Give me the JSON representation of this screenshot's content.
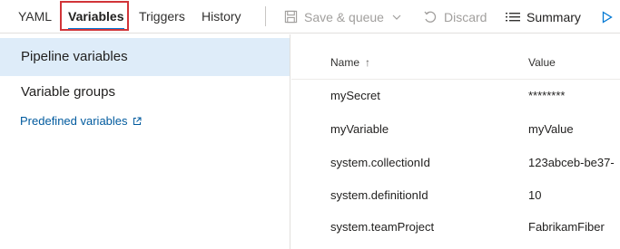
{
  "toolbar": {
    "tabs": [
      {
        "label": "YAML"
      },
      {
        "label": "Variables"
      },
      {
        "label": "Triggers"
      },
      {
        "label": "History"
      }
    ],
    "save_queue_label": "Save & queue",
    "discard_label": "Discard",
    "summary_label": "Summary"
  },
  "sidebar": {
    "items": [
      {
        "label": "Pipeline variables",
        "selected": true
      },
      {
        "label": "Variable groups",
        "selected": false
      }
    ],
    "predefined_link": "Predefined variables"
  },
  "table": {
    "columns": {
      "name": "Name",
      "value": "Value"
    },
    "rows": [
      {
        "name": "mySecret",
        "value": "********"
      },
      {
        "name": "myVariable",
        "value": "myValue"
      },
      {
        "name": "system.collectionId",
        "value": "123abceb-be37-"
      },
      {
        "name": "system.definitionId",
        "value": "10"
      },
      {
        "name": "system.teamProject",
        "value": "FabrikamFiber"
      }
    ]
  },
  "colors": {
    "accent": "#0078d4",
    "highlight": "#d13438",
    "selected_bg": "#deecf9",
    "link": "#005a9e"
  }
}
